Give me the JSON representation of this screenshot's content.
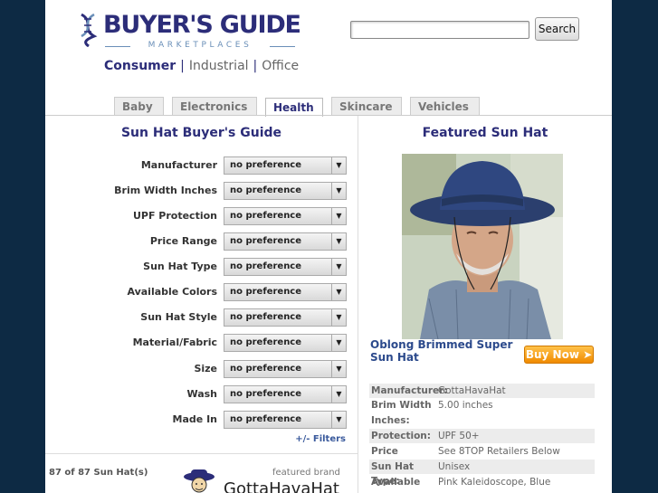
{
  "header": {
    "logo_title": "BUYER'S GUIDE",
    "logo_subtitle": "MARKETPLACES",
    "search_button": "Search",
    "search_value": "",
    "segments": [
      "Consumer",
      "Industrial",
      "Office"
    ],
    "segment_separator": "|"
  },
  "tabs": [
    "Baby",
    "Electronics",
    "Health",
    "Skincare",
    "Vehicles"
  ],
  "active_tab": "Health",
  "left": {
    "title": "Sun Hat Buyer's Guide",
    "filters": [
      {
        "label": "Manufacturer",
        "value": "no preference"
      },
      {
        "label": "Brim Width Inches",
        "value": "no preference"
      },
      {
        "label": "UPF Protection",
        "value": "no preference"
      },
      {
        "label": "Price Range",
        "value": "no preference"
      },
      {
        "label": "Sun Hat Type",
        "value": "no preference"
      },
      {
        "label": "Available Colors",
        "value": "no preference"
      },
      {
        "label": "Sun Hat Style",
        "value": "no preference"
      },
      {
        "label": "Material/Fabric",
        "value": "no preference"
      },
      {
        "label": "Size",
        "value": "no preference"
      },
      {
        "label": "Wash",
        "value": "no preference"
      },
      {
        "label": "Made In",
        "value": "no preference"
      }
    ],
    "filters_link": "+/- Filters",
    "result_count": "87 of 87 Sun Hat(s)",
    "featured_brand_label": "featured brand",
    "brand_name": "GottaHavaHat"
  },
  "right": {
    "title": "Featured Sun Hat",
    "product_name": "Oblong Brimmed Super Sun Hat",
    "buy_now": "Buy Now",
    "buy_now_arrow": "➤",
    "specs": [
      {
        "label": "Manufacturer:",
        "value": "GottaHavaHat"
      },
      {
        "label": "Brim Width Inches:",
        "value": "5.00 inches"
      },
      {
        "label": "Protection:",
        "value": "UPF 50+"
      },
      {
        "label": "Price Range:",
        "value": "See 8TOP Retailers Below"
      },
      {
        "label": "Sun Hat Type:",
        "value": "Unisex"
      },
      {
        "label": "Available",
        "value": "Pink Kaleidoscope, Blue"
      }
    ]
  },
  "colors": {
    "background": "#0d2a44",
    "brand_navy": "#2c2d79",
    "buy_now_orange": "#f08a00"
  }
}
